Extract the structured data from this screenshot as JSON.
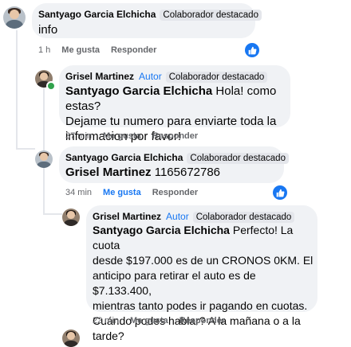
{
  "comments": [
    {
      "author": "Santyago Garcia Elchicha",
      "badge": "Colaborador destacado",
      "text": "info",
      "time": "1 h",
      "like": "Me gusta",
      "reply": "Responder"
    },
    {
      "author": "Grisel Martinez",
      "role": "Autor",
      "badge": "Colaborador destacado",
      "mention": "Santyago Garcia Elchicha",
      "text_l1": " Hola! como estas?",
      "text_l2": "Dejame tu numero para enviarte toda la",
      "text_l3": "informacion por favor!",
      "time": "37 min",
      "like": "Me gusta",
      "reply": "Responder"
    },
    {
      "author": "Santyago Garcia Elchicha",
      "badge": "Colaborador destacado",
      "mention": "Grisel Martinez",
      "text": " 1165672786",
      "time": "34 min",
      "like": "Me gusta",
      "reply": "Responder"
    },
    {
      "author": "Grisel Martinez",
      "role": "Autor",
      "badge": "Colaborador destacado",
      "mention": "Santyago Garcia Elchicha",
      "text_l1": " Perfecto! La cuota",
      "text_l2": "desde $197.000 es de un CRONOS 0KM. El",
      "text_l3": "anticipo para retirar el auto es de $7.133.400,",
      "text_l4": "mientras tanto podes ir pagando en cuotas.",
      "text_l5": "Cuándo podes hablar? A la mañana o a la",
      "text_l6": "tarde?",
      "time": "22 min",
      "like": "Me gusta",
      "reply": "Responder"
    }
  ],
  "icons": {
    "like": "thumbs-up-icon"
  },
  "colors": {
    "accent": "#1877f2",
    "bubble": "#f0f2f5",
    "meta": "#65676b"
  }
}
